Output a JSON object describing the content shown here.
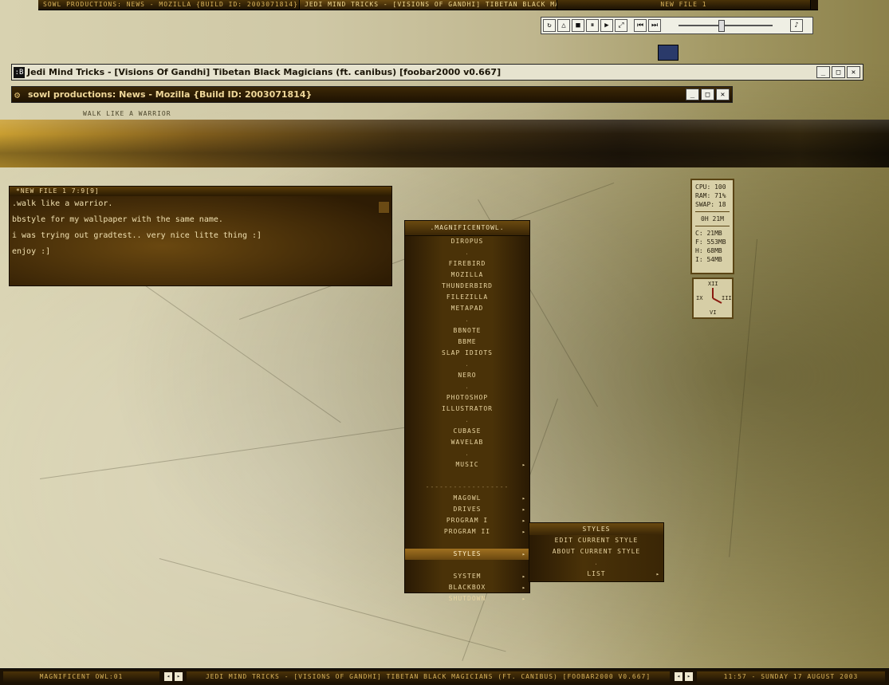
{
  "top_taskbar": {
    "tasks": [
      "SOWL PRODUCTIONS: NEWS - MOZILLA {BUILD ID: 2003071814}",
      "JEDI MIND TRICKS - [VISIONS OF GANDHI] TIBETAN BLACK MAGIC...",
      "NEW FILE 1"
    ]
  },
  "player": {
    "buttons": [
      "↻",
      "△",
      "■",
      "⏸",
      "▶",
      "⤢",
      "⏮",
      "⏭"
    ],
    "volume_fraction": 0.45,
    "note_icon": "♪"
  },
  "foobar_window": {
    "icon_text": ":B",
    "title": "Jedi Mind Tricks - [Visions Of Gandhi] Tibetan Black Magicians (ft. canibus)     [foobar2000 v0.667]"
  },
  "mozilla_window": {
    "icon_text": "⚙",
    "title": "sowl productions: News - Mozilla {Build ID: 2003071814}"
  },
  "window_controls": {
    "minimize": "_",
    "maximize": "□",
    "close": "✕"
  },
  "tagline": "WALK LIKE A WARRIOR",
  "note": {
    "header": "*NEW FILE 1  7:9[9]",
    "lines": [
      ".walk like a warrior.",
      "bbstyle for my wallpaper with the same name.",
      "i was trying out gradtest.. very nice litte thing :]",
      "enjoy :]"
    ]
  },
  "sysmon": {
    "cpu": "CPU: 100",
    "ram": "RAM: 71%",
    "swap": "SWAP: 18",
    "uptime": "0H 21M",
    "drives": [
      "C: 21MB",
      "F: 553MB",
      "H: 68MB",
      "I: 54MB"
    ]
  },
  "clock": {
    "xii": "XII",
    "ix": "IX",
    "iii": "III",
    "vi": "VI"
  },
  "menu": {
    "title": ".MAGNIFICENTOWL.",
    "items": [
      {
        "label": "DIROPUS",
        "sub": false,
        "selected": false
      },
      {
        "label": ".",
        "sub": false,
        "selected": false
      },
      {
        "label": "FIREBIRD",
        "sub": false,
        "selected": false
      },
      {
        "label": "MOZILLA",
        "sub": false,
        "selected": false
      },
      {
        "label": "THUNDERBIRD",
        "sub": false,
        "selected": false
      },
      {
        "label": "FILEZILLA",
        "sub": false,
        "selected": false
      },
      {
        "label": "METAPAD",
        "sub": false,
        "selected": false
      },
      {
        "label": ".",
        "sub": false,
        "selected": false
      },
      {
        "label": "BBNOTE",
        "sub": false,
        "selected": false
      },
      {
        "label": "BBME",
        "sub": false,
        "selected": false
      },
      {
        "label": "SLAP IDIOTS",
        "sub": false,
        "selected": false
      },
      {
        "label": ".",
        "sub": false,
        "selected": false
      },
      {
        "label": "NERO",
        "sub": false,
        "selected": false
      },
      {
        "label": ".",
        "sub": false,
        "selected": false
      },
      {
        "label": "PHOTOSHOP",
        "sub": false,
        "selected": false
      },
      {
        "label": "ILLUSTRATOR",
        "sub": false,
        "selected": false
      },
      {
        "label": ".",
        "sub": false,
        "selected": false
      },
      {
        "label": "CUBASE",
        "sub": false,
        "selected": false
      },
      {
        "label": "WAVELAB",
        "sub": false,
        "selected": false
      },
      {
        "label": ".",
        "sub": false,
        "selected": false
      },
      {
        "label": "MUSIC",
        "sub": true,
        "selected": false
      },
      {
        "label": "",
        "sub": false,
        "selected": false
      },
      {
        "label": "------------------",
        "sub": false,
        "selected": false
      },
      {
        "label": "MAGOWL",
        "sub": true,
        "selected": false
      },
      {
        "label": "DRIVES",
        "sub": true,
        "selected": false
      },
      {
        "label": "PROGRAM I",
        "sub": true,
        "selected": false
      },
      {
        "label": "PROGRAM II",
        "sub": true,
        "selected": false
      },
      {
        "label": "",
        "sub": false,
        "selected": false
      },
      {
        "label": "STYLES",
        "sub": true,
        "selected": true
      },
      {
        "label": "",
        "sub": false,
        "selected": false
      },
      {
        "label": "SYSTEM",
        "sub": true,
        "selected": false
      },
      {
        "label": "BLACKBOX",
        "sub": true,
        "selected": false
      },
      {
        "label": "SHUTDOWN",
        "sub": true,
        "selected": false
      }
    ],
    "arrow": "▸"
  },
  "submenu": {
    "title": "STYLES",
    "items": [
      {
        "label": "EDIT CURRENT STYLE",
        "sub": false
      },
      {
        "label": "ABOUT CURRENT STYLE",
        "sub": false
      },
      {
        "label": ".",
        "sub": false
      },
      {
        "label": "LIST",
        "sub": true
      }
    ]
  },
  "bottom_taskbar": {
    "workspace": "MAGNIFICENT OWL:01",
    "prev": "◂",
    "next": "▸",
    "current_task": "JEDI MIND TRICKS - [VISIONS OF GANDHI] TIBETAN BLACK MAGICIANS (FT. CANIBUS)     [FOOBAR2000 V0.667]",
    "datetime": "11:57 - SUNDAY 17 AUGUST 2003"
  }
}
